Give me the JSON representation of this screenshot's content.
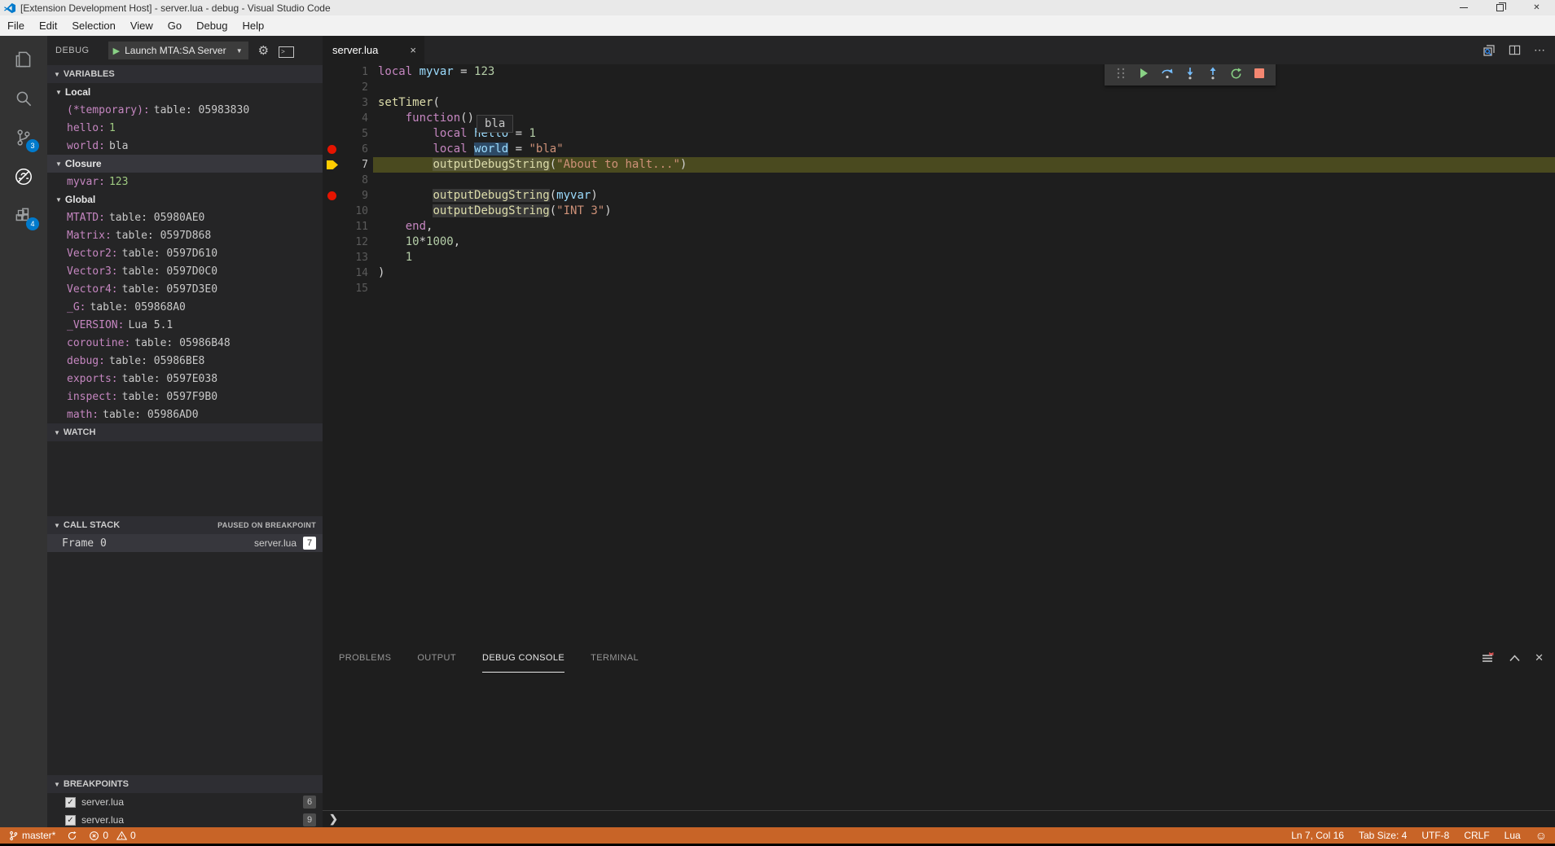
{
  "colors": {
    "accent": "#007acc",
    "statusbar_debug": "#c86427",
    "breakpoint": "#e51400",
    "current_line_marker": "#ffcc00",
    "current_line_bg": "#4a4a1f"
  },
  "titlebar": {
    "title": "[Extension Development Host] - server.lua - debug - Visual Studio Code",
    "controls": {
      "minimize": "minimize",
      "restore": "restore",
      "close": "✕"
    }
  },
  "menubar": {
    "items": [
      "File",
      "Edit",
      "Selection",
      "View",
      "Go",
      "Debug",
      "Help"
    ]
  },
  "activitybar": {
    "items": [
      {
        "name": "explorer",
        "badge": ""
      },
      {
        "name": "search",
        "badge": ""
      },
      {
        "name": "source-control",
        "badge": "3"
      },
      {
        "name": "debug",
        "badge": "",
        "active": true
      },
      {
        "name": "extensions",
        "badge": "4"
      }
    ]
  },
  "sidebar": {
    "header": {
      "label": "DEBUG",
      "launch_config": "Launch MTA:SA Server",
      "caret": "▼",
      "gear": "⚙",
      "play": "▶"
    },
    "variables": {
      "title": "VARIABLES",
      "sections": [
        {
          "name": "Local",
          "selected": false,
          "rows": [
            {
              "k": "(*temporary)",
              "v": "table: 05983830",
              "num": false
            },
            {
              "k": "hello",
              "v": "1",
              "num": true
            },
            {
              "k": "world",
              "v": "bla",
              "num": false
            }
          ]
        },
        {
          "name": "Closure",
          "selected": true,
          "rows": [
            {
              "k": "myvar",
              "v": "123",
              "num": true
            }
          ]
        },
        {
          "name": "Global",
          "selected": false,
          "rows": [
            {
              "k": "MTATD",
              "v": "table: 05980AE0",
              "num": false
            },
            {
              "k": "Matrix",
              "v": "table: 0597D868",
              "num": false
            },
            {
              "k": "Vector2",
              "v": "table: 0597D610",
              "num": false
            },
            {
              "k": "Vector3",
              "v": "table: 0597D0C0",
              "num": false
            },
            {
              "k": "Vector4",
              "v": "table: 0597D3E0",
              "num": false
            },
            {
              "k": "_G",
              "v": "table: 059868A0",
              "num": false
            },
            {
              "k": "_VERSION",
              "v": "Lua 5.1",
              "num": false
            },
            {
              "k": "coroutine",
              "v": "table: 05986B48",
              "num": false
            },
            {
              "k": "debug",
              "v": "table: 05986BE8",
              "num": false
            },
            {
              "k": "exports",
              "v": "table: 0597E038",
              "num": false
            },
            {
              "k": "inspect",
              "v": "table: 0597F9B0",
              "num": false
            },
            {
              "k": "math",
              "v": "table: 05986AD0",
              "num": false
            }
          ]
        }
      ]
    },
    "watch": {
      "title": "WATCH"
    },
    "callstack": {
      "title": "CALL STACK",
      "status": "PAUSED ON BREAKPOINT",
      "frames": [
        {
          "name": "Frame 0",
          "file": "server.lua",
          "line": "7"
        }
      ]
    },
    "breakpoints": {
      "title": "BREAKPOINTS",
      "rows": [
        {
          "file": "server.lua",
          "line": "6",
          "checked": true
        },
        {
          "file": "server.lua",
          "line": "9",
          "checked": true
        }
      ]
    }
  },
  "editor": {
    "tab": {
      "label": "server.lua",
      "close": "×"
    },
    "actions": {
      "more": "⋯"
    },
    "tooltip": {
      "text": "bla"
    },
    "lines": [
      {
        "n": "1",
        "t": [
          [
            "kw",
            "local"
          ],
          [
            "pl",
            " "
          ],
          [
            "var",
            "myvar"
          ],
          [
            "pl",
            " = "
          ],
          [
            "num",
            "123"
          ]
        ]
      },
      {
        "n": "2",
        "t": []
      },
      {
        "n": "3",
        "t": [
          [
            "fn",
            "setTimer"
          ],
          [
            "pl",
            "("
          ]
        ]
      },
      {
        "n": "4",
        "t": [
          [
            "pl",
            "    "
          ],
          [
            "kw",
            "function"
          ],
          [
            "pl",
            "()"
          ]
        ]
      },
      {
        "n": "5",
        "t": [
          [
            "pl",
            "        "
          ],
          [
            "kw",
            "local"
          ],
          [
            "pl",
            " "
          ],
          [
            "var",
            "hello"
          ],
          [
            "pl",
            " = "
          ],
          [
            "num",
            "1"
          ]
        ]
      },
      {
        "n": "6",
        "gutter": "breakpoint",
        "t": [
          [
            "pl",
            "        "
          ],
          [
            "kw",
            "local"
          ],
          [
            "pl",
            " "
          ],
          [
            "var",
            "world",
            "word"
          ],
          [
            "pl",
            " = "
          ],
          [
            "str",
            "\"bla\""
          ]
        ]
      },
      {
        "n": "7",
        "gutter": "current",
        "current": true,
        "t": [
          [
            "pl",
            "        "
          ],
          [
            "fn",
            "outputDebugString",
            "occ"
          ],
          [
            "pl",
            "("
          ],
          [
            "str",
            "\"About to halt...\""
          ],
          [
            "pl",
            ")"
          ]
        ]
      },
      {
        "n": "8",
        "t": []
      },
      {
        "n": "9",
        "gutter": "breakpoint",
        "t": [
          [
            "pl",
            "        "
          ],
          [
            "fn",
            "outputDebugString",
            "occ"
          ],
          [
            "pl",
            "("
          ],
          [
            "var",
            "myvar"
          ],
          [
            "pl",
            ")"
          ]
        ]
      },
      {
        "n": "10",
        "t": [
          [
            "pl",
            "        "
          ],
          [
            "fn",
            "outputDebugString",
            "occ"
          ],
          [
            "pl",
            "("
          ],
          [
            "str",
            "\"INT 3\""
          ],
          [
            "pl",
            ")"
          ]
        ]
      },
      {
        "n": "11",
        "t": [
          [
            "pl",
            "    "
          ],
          [
            "kw",
            "end"
          ],
          [
            "pl",
            ","
          ]
        ]
      },
      {
        "n": "12",
        "t": [
          [
            "pl",
            "    "
          ],
          [
            "num",
            "10"
          ],
          [
            "pl",
            "*"
          ],
          [
            "num",
            "1000"
          ],
          [
            "pl",
            ","
          ]
        ]
      },
      {
        "n": "13",
        "t": [
          [
            "pl",
            "    "
          ],
          [
            "num",
            "1"
          ]
        ]
      },
      {
        "n": "14",
        "t": [
          [
            "pl",
            ")"
          ]
        ]
      },
      {
        "n": "15",
        "t": []
      }
    ]
  },
  "debug_toolbar": {
    "icons": [
      "drag-handle",
      "continue",
      "step-over",
      "step-into",
      "step-out",
      "restart",
      "stop"
    ]
  },
  "panel": {
    "tabs": [
      {
        "label": "PROBLEMS",
        "active": false
      },
      {
        "label": "OUTPUT",
        "active": false
      },
      {
        "label": "DEBUG CONSOLE",
        "active": true
      },
      {
        "label": "TERMINAL",
        "active": false
      }
    ],
    "actions": {
      "maximize": "⌃",
      "close": "✕"
    },
    "console_prompt": "❯"
  },
  "statusbar": {
    "branch": "master*",
    "errors": "0",
    "warnings": "0",
    "cursor": "Ln 7, Col 16",
    "tabsize": "Tab Size: 4",
    "encoding": "UTF-8",
    "eol": "CRLF",
    "language": "Lua",
    "feedback": "☺"
  }
}
